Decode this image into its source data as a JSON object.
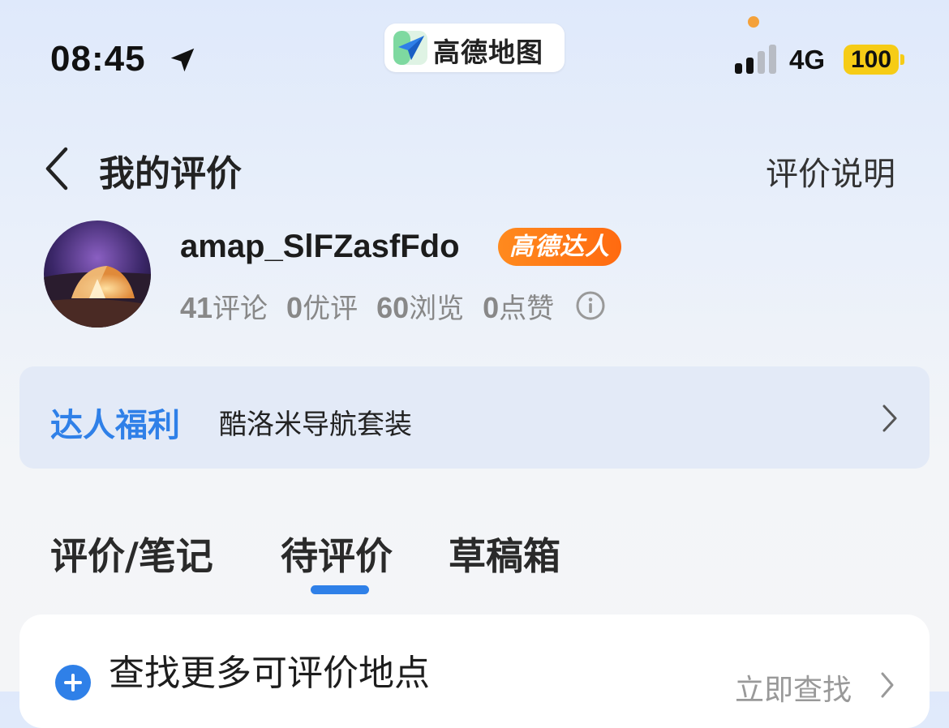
{
  "status_bar": {
    "time": "08:45",
    "location_icon": "location-arrow-icon",
    "app_name": "高德地图",
    "network": "4G",
    "battery": "100",
    "colors": {
      "battery": "#f6cc16",
      "camera_dot": "#f4a13a"
    }
  },
  "header": {
    "back_icon": "chevron-left-icon",
    "title": "我的评价",
    "help_link": "评价说明"
  },
  "profile": {
    "username": "amap_SlFZasfFdo",
    "badge": "高德达人",
    "stats": [
      {
        "count": "41",
        "label": "评论"
      },
      {
        "count": "0",
        "label": "优评"
      },
      {
        "count": "60",
        "label": "浏览"
      },
      {
        "count": "0",
        "label": "点赞"
      }
    ],
    "info_icon": "info-circle-icon"
  },
  "benefit": {
    "title": "达人福利",
    "text": "酷洛米导航套装",
    "chevron": "chevron-right-icon"
  },
  "tabs": [
    {
      "label": "评价/笔记",
      "active": false
    },
    {
      "label": "待评价",
      "active": true
    },
    {
      "label": "草稿箱",
      "active": false
    }
  ],
  "find_more": {
    "icon": "plus-circle-icon",
    "title": "查找更多可评价地点",
    "action": "立即查找"
  },
  "colors": {
    "accent": "#2f80e8",
    "badge_orange": "#ff7a18",
    "benefit_bg": "#e3eaf7"
  }
}
